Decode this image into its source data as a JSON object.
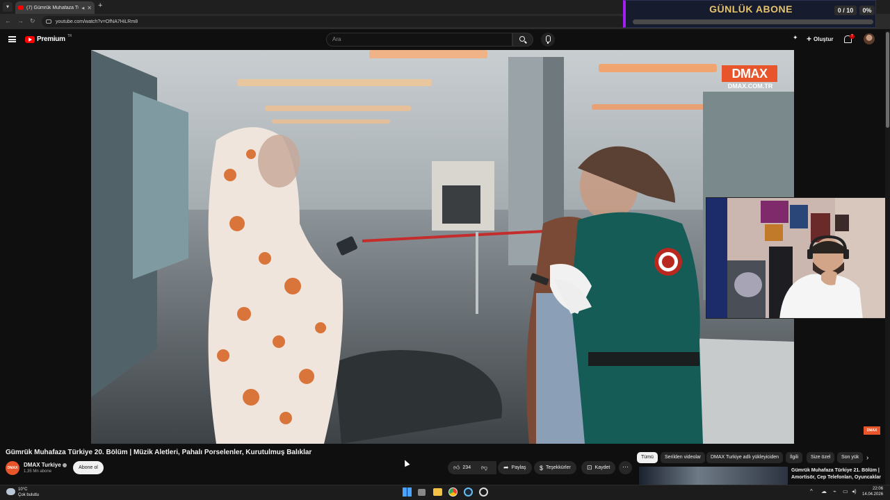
{
  "browser": {
    "tab_title": "(7) Gümrük Muhafaza Türk",
    "url": "youtube.com/watch?v=OfNA7HiLRm8"
  },
  "overlay": {
    "title": "GÜNLÜK ABONE",
    "count": "0 / 10",
    "percent": "0%",
    "progress": 0
  },
  "header": {
    "brand": "Premium",
    "region": "TR",
    "search_placeholder": "Ara",
    "create_label": "Oluştur",
    "notification_count": "7"
  },
  "video": {
    "watermark": "DMAX",
    "watermark_url": "DMAX.COM.TR",
    "corner_logo": "DMAX"
  },
  "details": {
    "title": "Gümrük Muhafaza Türkiye 20. Bölüm | Müzik Aletleri, Pahalı Porselenler, Kurutulmuş Balıklar",
    "channel_avatar": "DMAX",
    "channel_name": "DMAX Turkiye",
    "subscribers": "1,35 Mn abone",
    "subscribe_label": "Abone ol",
    "likes": "234",
    "share_label": "Paylaş",
    "thanks_label": "Teşekkürler",
    "save_label": "Kaydet"
  },
  "chips": [
    "Tümü",
    "Serilden videolar",
    "DMAX Turkiye adlı yükleyiciden",
    "İlgili",
    "Size özel",
    "Son yük"
  ],
  "recommendation": {
    "title": "Gümrük Muhafaza Türkiye 21. Bölüm | Amortisör, Cep Telefonları, Oyuncaklar"
  },
  "taskbar": {
    "temperature": "10°C",
    "weather": "Çok bulutlu",
    "time": "22:06",
    "date": "14.04.2026"
  },
  "colors": {
    "accent": "#ff0000",
    "dmax": "#e8552b",
    "overlay_gold": "#e7c36b"
  }
}
